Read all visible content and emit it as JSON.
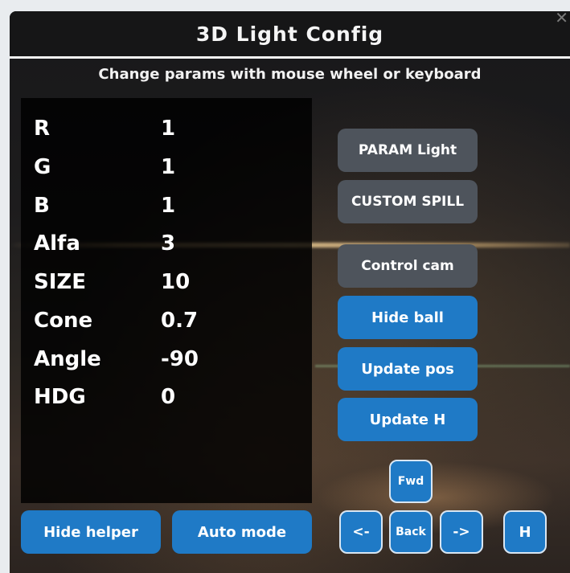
{
  "window": {
    "title": "3D Light Config",
    "subtitle": "Change params with mouse wheel or keyboard"
  },
  "params": [
    {
      "label": "R",
      "value": "1"
    },
    {
      "label": "G",
      "value": "1"
    },
    {
      "label": "B",
      "value": "1"
    },
    {
      "label": "Alfa",
      "value": "3"
    },
    {
      "label": "SIZE",
      "value": "10"
    },
    {
      "label": "Cone",
      "value": "0.7"
    },
    {
      "label": "Angle",
      "value": "-90"
    },
    {
      "label": "HDG",
      "value": "0"
    }
  ],
  "buttons": {
    "param_light": "PARAM Light",
    "custom_spill": "CUSTOM SPILL",
    "control_cam": "Control cam",
    "hide_ball": "Hide ball",
    "update_pos": "Update pos",
    "update_h": "Update H",
    "hide_helper": "Hide helper",
    "auto_mode": "Auto mode",
    "fwd": "Fwd",
    "back": "Back",
    "left": "<-",
    "right": "->",
    "h": "H"
  },
  "colors": {
    "button_grey": "#4e545c",
    "button_blue": "#1f7ac6",
    "panel_bg": "#000000",
    "title_bg": "#161617"
  },
  "icons": {
    "close": "close-icon"
  }
}
